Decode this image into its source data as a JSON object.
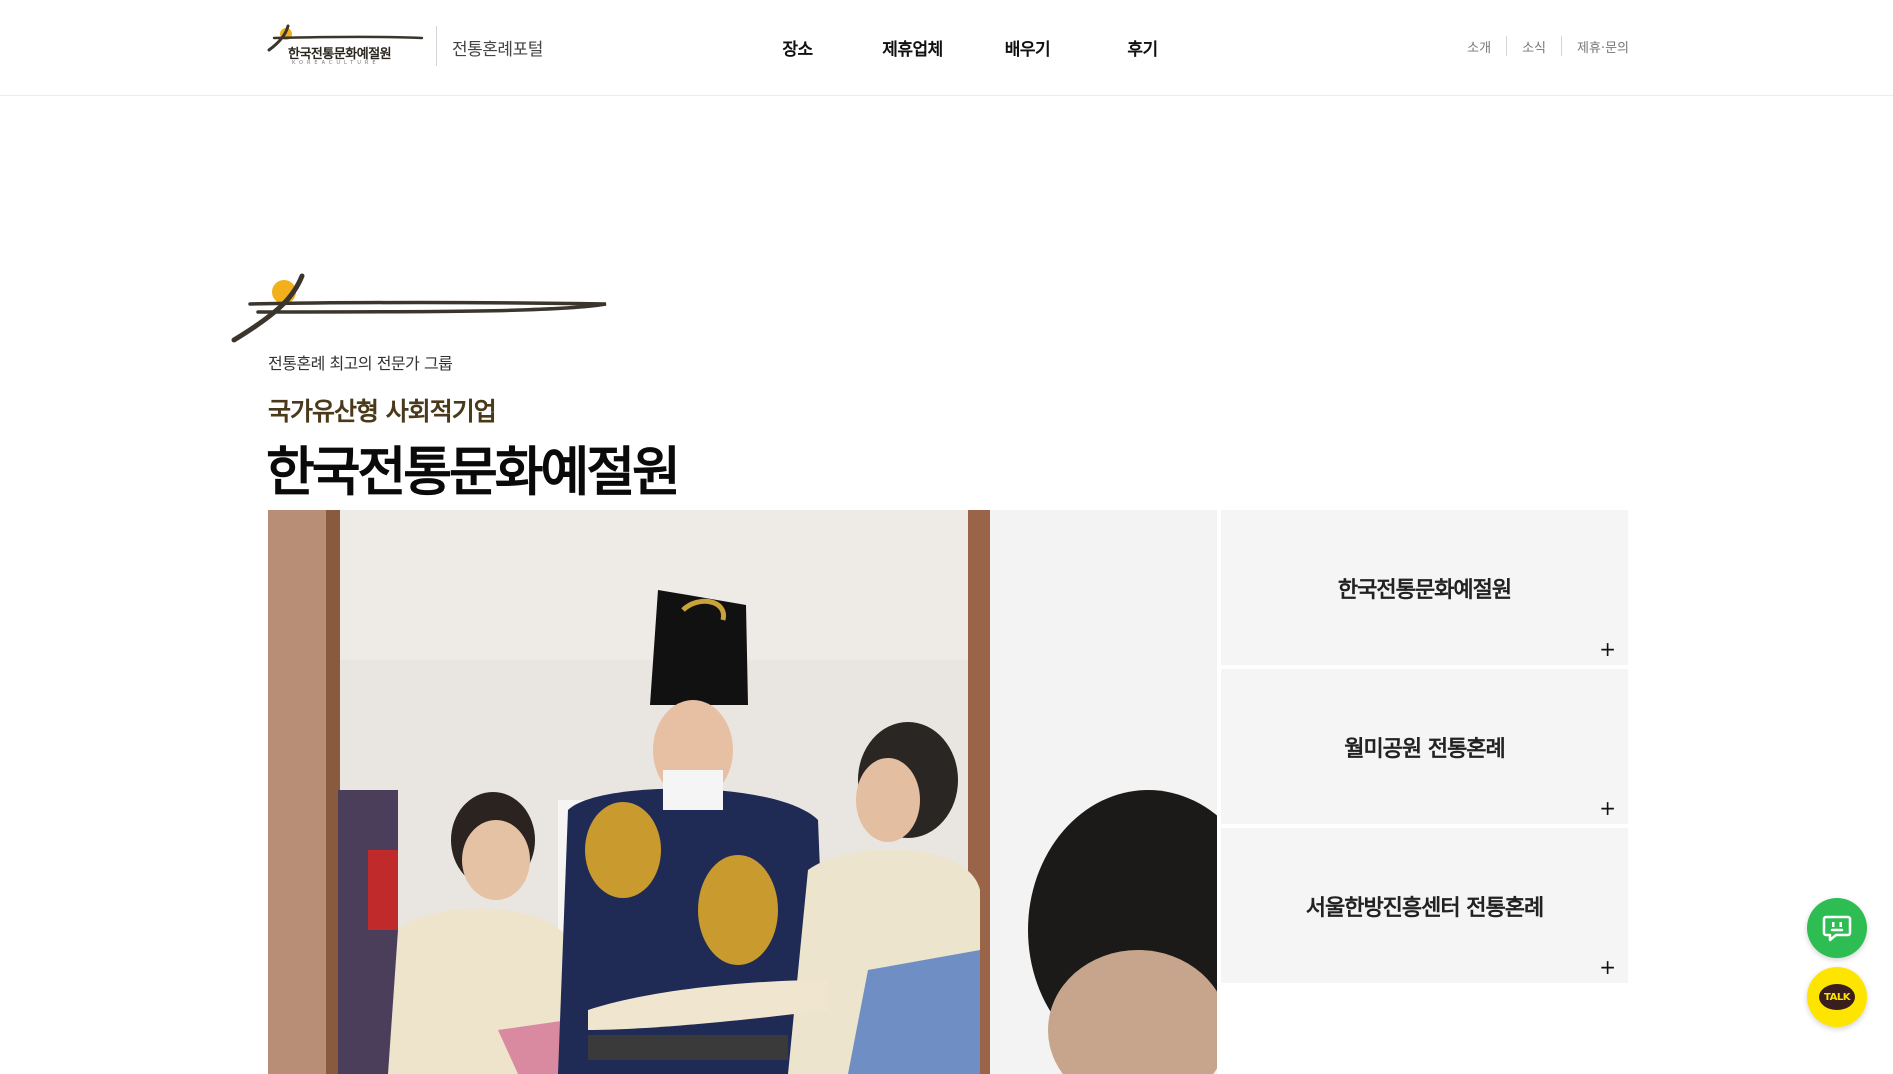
{
  "header": {
    "logo_text": "한국전통문화예절원",
    "logo_sub": "KOREACULTURE",
    "portal_title": "전통혼례포털",
    "nav": [
      {
        "label": "장소"
      },
      {
        "label": "제휴업체"
      },
      {
        "label": "배우기"
      },
      {
        "label": "후기"
      }
    ],
    "util": [
      {
        "label": "소개"
      },
      {
        "label": "소식"
      },
      {
        "label": "제휴·문의"
      }
    ]
  },
  "hero": {
    "tagline": "전통혼례 최고의 전문가 그룹",
    "subtitle": "국가유산형 사회적기업",
    "title": "한국전통문화예절원"
  },
  "cards": [
    {
      "title": "한국전통문화예절원",
      "plus": "+"
    },
    {
      "title": "월미공원 전통혼례",
      "plus": "+"
    },
    {
      "title": "서울한방진흥센터 전통혼례",
      "plus": "+"
    }
  ],
  "floating": {
    "talk_label": "TALK"
  },
  "colors": {
    "brand_gold": "#f2b11a",
    "brand_brown": "#3b352c",
    "subtitle": "#4a3a1a",
    "card_bg": "#f5f5f5",
    "chat_green": "#2dbd52",
    "kakao_yellow": "#fee500"
  }
}
